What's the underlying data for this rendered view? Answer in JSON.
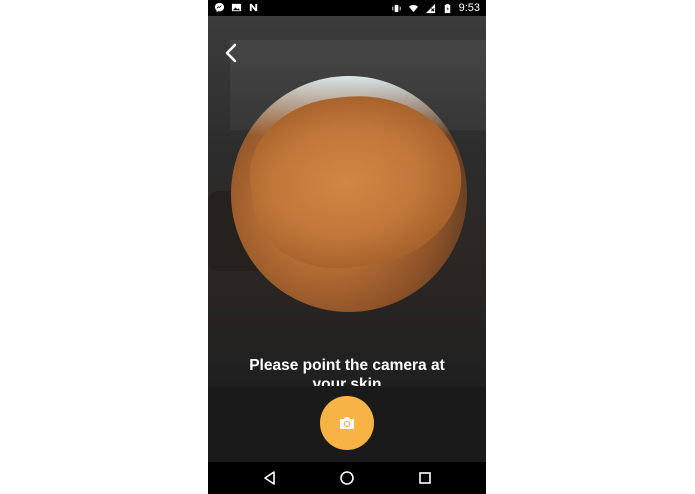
{
  "status_bar": {
    "left_icons": [
      "messenger-icon",
      "image-icon",
      "n-icon"
    ],
    "right_icons": [
      "vibrate-icon",
      "wifi-icon",
      "signal-icon",
      "battery-icon"
    ],
    "time": "9:53"
  },
  "camera": {
    "prompt_line1": "Please point the camera at",
    "prompt_line2": "your skin"
  },
  "colors": {
    "accent": "#f7b345",
    "panel": "#1a1a1a"
  },
  "nav": {
    "buttons": [
      "back-triangle-icon",
      "home-circle-icon",
      "recents-square-icon"
    ]
  }
}
